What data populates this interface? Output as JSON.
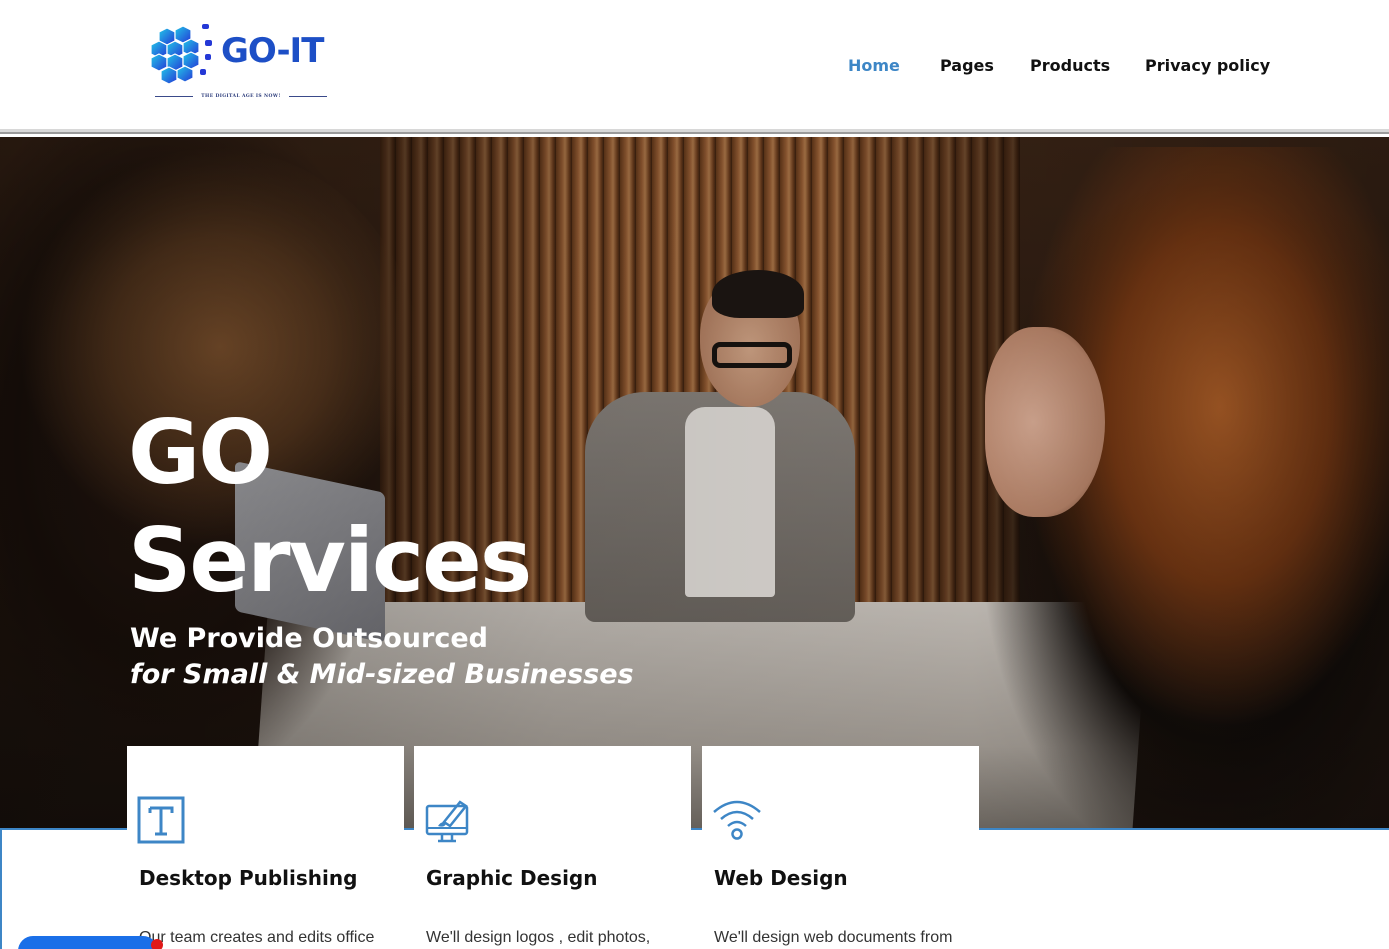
{
  "brand": {
    "name": "GO-IT",
    "tagline": "THE DIGITAL AGE IS NOW!"
  },
  "nav": {
    "items": [
      {
        "label": "Home",
        "active": true
      },
      {
        "label": "Pages",
        "active": false
      },
      {
        "label": "Products",
        "active": false
      },
      {
        "label": "Privacy policy",
        "active": false
      }
    ]
  },
  "hero": {
    "title_line1": "GO",
    "title_line2": "Services",
    "subtitle_line1": "We Provide Outsourced",
    "subtitle_line2": "for Small & Mid-sized Businesses"
  },
  "services": [
    {
      "icon": "text-icon",
      "title": "Desktop Publishing",
      "text": "Our team creates and edits office"
    },
    {
      "icon": "design-monitor-icon",
      "title": "Graphic Design",
      "text": "We'll design logos , edit photos,"
    },
    {
      "icon": "wifi-icon",
      "title": "Web Design",
      "text": "We'll design web documents from"
    }
  ],
  "colors": {
    "accent": "#3d86c6",
    "logo_blue": "#1d4fc6",
    "chat": "#1a6fe8",
    "notification": "#e01818"
  }
}
